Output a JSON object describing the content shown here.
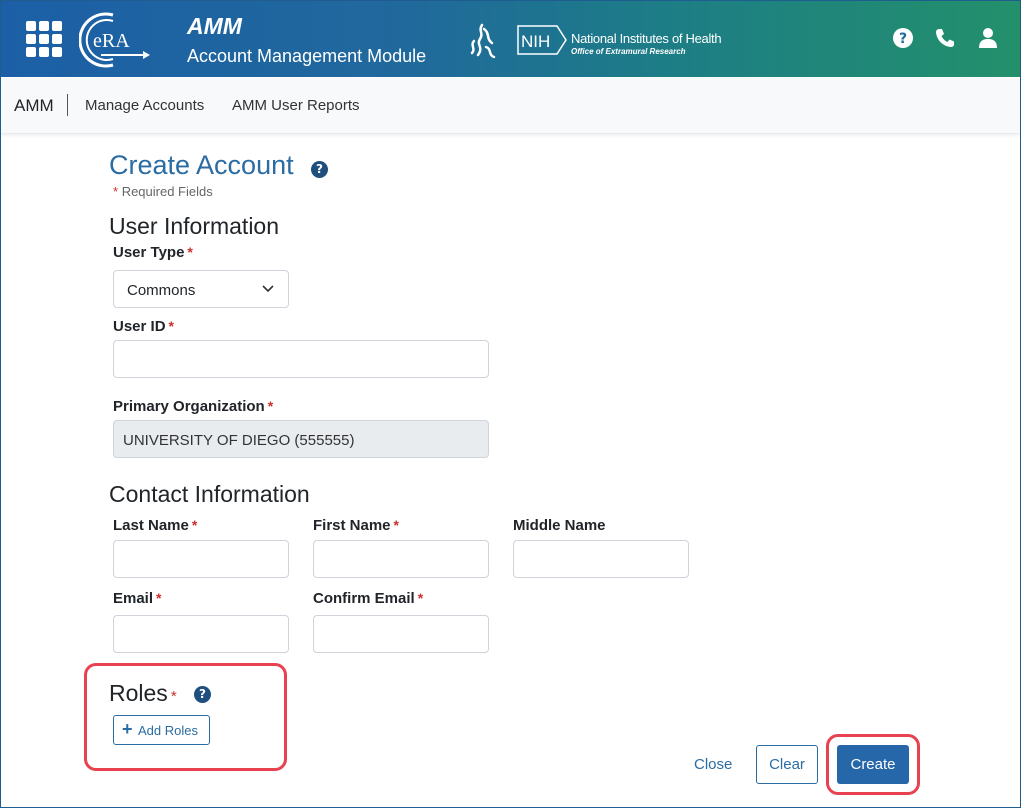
{
  "header": {
    "app_short": "AMM",
    "app_full": "Account Management Module",
    "logo_text": "eRA",
    "nih_badge": "NIH",
    "nih_name": "National Institutes of Health",
    "nih_office": "Office of Extramural Research",
    "icons": [
      "apps-grid-icon",
      "help-icon",
      "phone-icon",
      "user-icon"
    ]
  },
  "nav": {
    "brand": "AMM",
    "links": [
      "Manage Accounts",
      "AMM User Reports"
    ]
  },
  "form": {
    "title": "Create Account",
    "required_note": "Required Fields",
    "required_marker": "*",
    "user_info": {
      "heading": "User Information",
      "user_type_label": "User Type",
      "user_type_value": "Commons",
      "user_id_label": "User ID",
      "user_id_value": "",
      "primary_org_label": "Primary Organization",
      "primary_org_value": "UNIVERSITY OF DIEGO (555555)"
    },
    "contact_info": {
      "heading": "Contact Information",
      "last_name_label": "Last Name",
      "first_name_label": "First Name",
      "middle_name_label": "Middle Name",
      "email_label": "Email",
      "confirm_email_label": "Confirm Email"
    },
    "roles": {
      "heading": "Roles",
      "add_button": "Add Roles"
    },
    "actions": {
      "close": "Close",
      "clear": "Clear",
      "create": "Create"
    }
  },
  "colors": {
    "header_gradient_start": "#1c5fa6",
    "header_gradient_end": "#23906b",
    "primary": "#2567a8",
    "title": "#2b6ca3",
    "required": "#c9302c",
    "highlight": "#e8414f"
  }
}
